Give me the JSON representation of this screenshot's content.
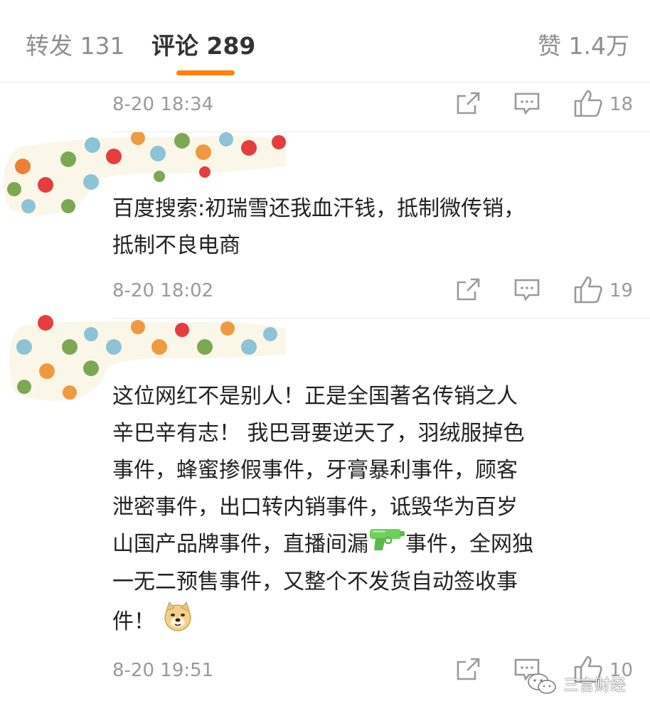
{
  "tabs": {
    "repost": "转发 131",
    "comments": "评论 289",
    "likes": "赞 1.4万"
  },
  "comments": [
    {
      "time": "8-20 18:34",
      "likes": "18",
      "text": ""
    },
    {
      "time": "8-20 18:02",
      "likes": "19",
      "text": "百度搜索:初瑞雪还我血汗钱，抵制微传销，\n抵制不良电商"
    },
    {
      "time": "8-20 19:51",
      "likes": "10",
      "text": "这位网红不是别人！正是全国著名传销之人\n辛巴辛有志！ 我巴哥要逆天了，羽绒服掉色\n事件，蜂蜜掺假事件，牙膏暴利事件，顾客\n泄密事件，出口转内销事件，诋毁华为百岁\n山国产品牌事件，直播间漏",
      "text_b": "事件，全网独\n一无二预售事件，又整个不发货自动签收事\n件！ "
    }
  ],
  "watermark": "三言财经",
  "colors": {
    "accent": "#ff8200"
  }
}
